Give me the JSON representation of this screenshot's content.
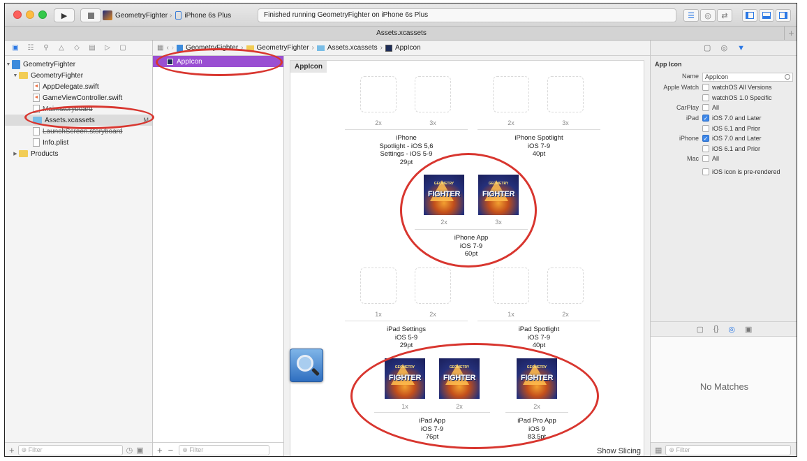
{
  "toolbar": {
    "scheme_target": "GeometryFighter",
    "scheme_device": "iPhone 6s Plus",
    "status_text": "Finished running GeometryFighter on iPhone 6s Plus"
  },
  "tab": {
    "title": "Assets.xcassets"
  },
  "navigator": {
    "items": [
      {
        "label": "GeometryFighter"
      },
      {
        "label": "GeometryFighter"
      },
      {
        "label": "AppDelegate.swift"
      },
      {
        "label": "GameViewController.swift"
      },
      {
        "label": "Main.storyboard"
      },
      {
        "label": "Assets.xcassets",
        "badge": "M"
      },
      {
        "label": "LaunchScreen.storyboard"
      },
      {
        "label": "Info.plist"
      },
      {
        "label": "Products"
      }
    ],
    "filter_placeholder": "Filter"
  },
  "jumpbar": {
    "crumbs": [
      "GeometryFighter",
      "GeometryFighter",
      "Assets.xcassets",
      "AppIcon"
    ]
  },
  "asset_list": {
    "selected": "AppIcon",
    "filter_placeholder": "Filter"
  },
  "editor": {
    "set_title": "AppIcon",
    "icon_text": "FIGHTER",
    "icon_subtext": "GEOMETRY",
    "groups": [
      {
        "line1": "iPhone",
        "line2": "Spotlight - iOS 5,6",
        "line3": "Settings - iOS 5-9",
        "line4": "29pt",
        "scales": [
          "2x",
          "3x"
        ]
      },
      {
        "line1": "iPhone Spotlight",
        "line2": "iOS 7-9",
        "line3": "40pt",
        "scales": [
          "2x",
          "3x"
        ]
      },
      {
        "line1": "iPhone App",
        "line2": "iOS 7-9",
        "line3": "60pt",
        "scales": [
          "2x",
          "3x"
        ]
      },
      {
        "line1": "iPad Settings",
        "line2": "iOS 5-9",
        "line3": "29pt",
        "scales": [
          "1x",
          "2x"
        ]
      },
      {
        "line1": "iPad Spotlight",
        "line2": "iOS 7-9",
        "line3": "40pt",
        "scales": [
          "1x",
          "2x"
        ]
      },
      {
        "line1": "iPad App",
        "line2": "iOS 7-9",
        "line3": "76pt",
        "scales": [
          "1x",
          "2x"
        ]
      },
      {
        "line1": "iPad Pro App",
        "line2": "iOS 9",
        "line3": "83.5pt",
        "scales": [
          "2x"
        ]
      }
    ],
    "show_slicing": "Show Slicing"
  },
  "inspector": {
    "heading": "App Icon",
    "name_label": "Name",
    "name_value": "AppIcon",
    "apple_watch_label": "Apple Watch",
    "watch_opt1": "watchOS All Versions",
    "watch_opt2": "watchOS 1.0 Specific",
    "carplay_label": "CarPlay",
    "carplay_opt": "All",
    "ipad_label": "iPad",
    "ipad_opt1": "iOS 7.0 and Later",
    "ipad_opt2": "iOS 6.1 and Prior",
    "iphone_label": "iPhone",
    "iphone_opt1": "iOS 7.0 and Later",
    "iphone_opt2": "iOS 6.1 and Prior",
    "mac_label": "Mac",
    "mac_opt": "All",
    "prerendered": "iOS icon is pre-rendered",
    "no_matches": "No Matches",
    "filter_placeholder": "Filter"
  },
  "colors": {
    "selection_purple": "#9a4fd2",
    "annotation_red": "#d8362f",
    "accent_blue": "#2b78e4"
  }
}
